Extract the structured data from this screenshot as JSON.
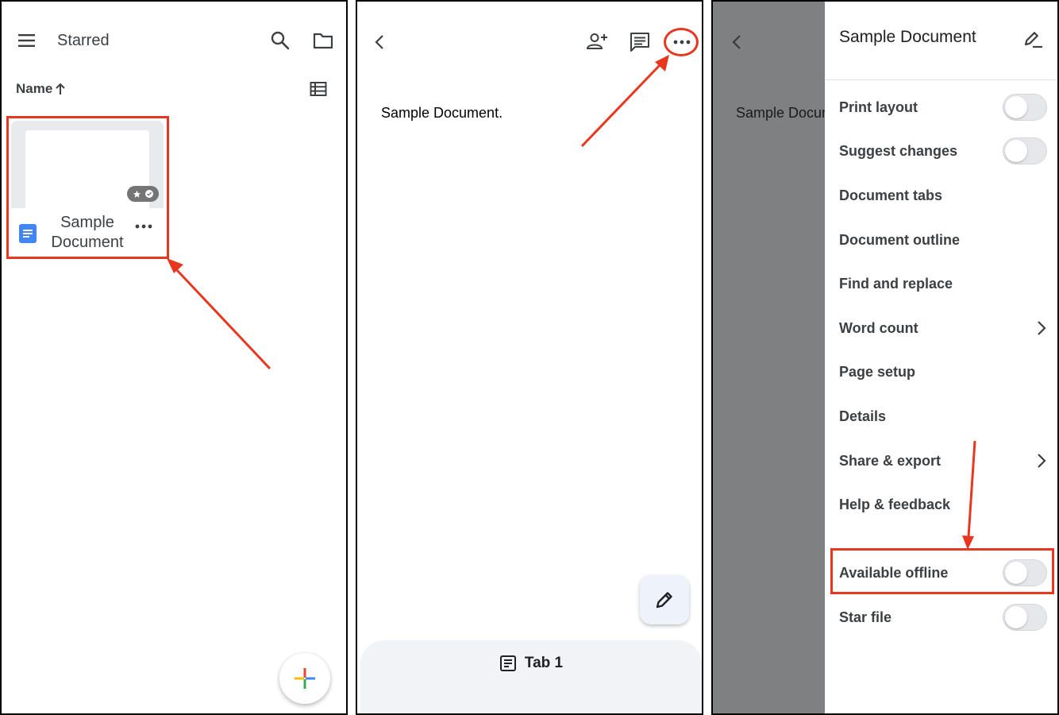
{
  "panel1": {
    "title": "Starred",
    "sort_label": "Name",
    "file": {
      "name": "Sample Document"
    }
  },
  "panel2": {
    "doc_text": "Sample Document.",
    "tab_label": "Tab 1"
  },
  "panel3": {
    "doc_preview_text": "Sample Document",
    "drawer_title": "Sample Document",
    "menu": [
      {
        "label": "Print layout",
        "control": "toggle",
        "on": false
      },
      {
        "label": "Suggest changes",
        "control": "toggle",
        "on": false
      },
      {
        "label": "Document tabs",
        "control": "none"
      },
      {
        "label": "Document outline",
        "control": "none"
      },
      {
        "label": "Find and replace",
        "control": "none"
      },
      {
        "label": "Word count",
        "control": "chevron"
      },
      {
        "label": "Page setup",
        "control": "none"
      },
      {
        "label": "Details",
        "control": "none"
      },
      {
        "label": "Share & export",
        "control": "chevron"
      },
      {
        "label": "Help & feedback",
        "control": "none"
      },
      {
        "label": "Available offline",
        "control": "toggle",
        "on": false
      },
      {
        "label": "Star file",
        "control": "toggle",
        "on": false
      }
    ]
  },
  "colors": {
    "highlight": "#e8371f",
    "docs_blue": "#4285f4",
    "scrim": "#7f8081",
    "tab_bar": "#f1f3f7"
  }
}
